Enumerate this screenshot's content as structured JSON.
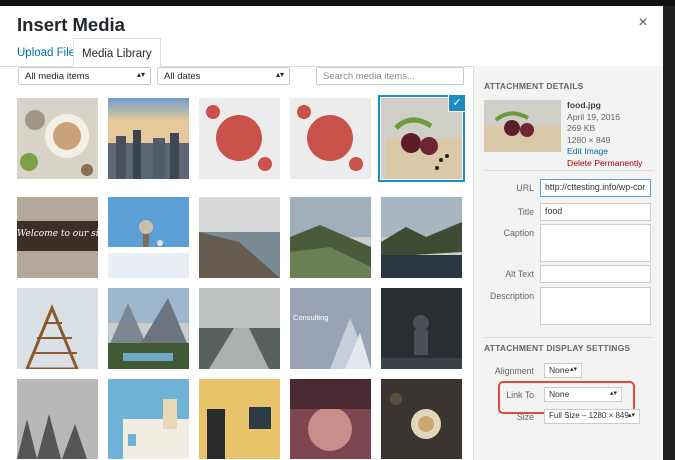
{
  "modal": {
    "title": "Insert Media",
    "close_glyph": "×"
  },
  "tabs": [
    {
      "label": "Upload Files"
    },
    {
      "label": "Media Library"
    }
  ],
  "filters": {
    "media_type": "All media items",
    "dates": "All dates",
    "search_placeholder": "Search media items..."
  },
  "attachment": {
    "heading": "ATTACHMENT DETAILS",
    "filename": "food.jpg",
    "date": "April 19, 2016",
    "size": "269 KB",
    "dimensions": "1280 × 849",
    "edit_link": "Edit Image",
    "delete_link": "Delete Permanently",
    "fields": {
      "url_label": "URL",
      "url_value": "http://cttesting.info/wp-cor",
      "title_label": "Title",
      "title_value": "food",
      "caption_label": "Caption",
      "alt_label": "Alt Text",
      "description_label": "Description"
    }
  },
  "display_settings": {
    "heading": "ATTACHMENT DISPLAY SETTINGS",
    "alignment_label": "Alignment",
    "alignment_value": "None",
    "link_to_label": "Link To",
    "link_to_value": "None",
    "size_label": "Size",
    "size_value": "Full Size – 1280 × 849"
  },
  "thumb_texts": {
    "welcome": "Welcome to our site",
    "consulting": "Consulting"
  },
  "colors": {
    "accent": "#0073aa",
    "selected": "#1e8cbe",
    "delete": "#aa0000",
    "highlight": "#e14b3b"
  }
}
